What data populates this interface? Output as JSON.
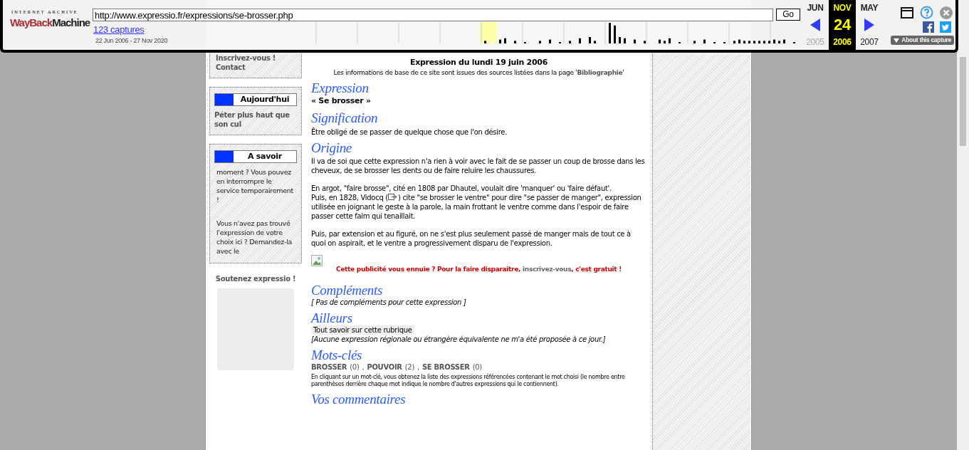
{
  "wayback": {
    "logo_top": "INTERNET ARCHIVE",
    "logo_wayback": "WayBack",
    "logo_machine": "Machine",
    "url": "http://www.expressio.fr/expressions/se-brosser.php",
    "go": "Go",
    "captures": "123 captures",
    "range": "22 Jun 2006 - 27 Nov 2020",
    "months": [
      {
        "month": "JUN",
        "year": "2005",
        "selected": false
      },
      {
        "month": "NOV",
        "day": "24",
        "year": "2006",
        "selected": true
      },
      {
        "month": "MAY",
        "year": "2007",
        "selected": false
      }
    ],
    "about": "About this capture"
  },
  "sidebar": {
    "links": [
      "Inscrivez-vous !",
      "Contact"
    ],
    "boxes": [
      {
        "title": "Aujourd'hui",
        "kind": "link",
        "text": "Péter plus haut que son cul"
      },
      {
        "title": "A savoir",
        "kind": "paragraphs",
        "paragraphs": [
          "moment ? Vous pouvez en interrompre le service temporairement !",
          "Vous n'avez pas trouvé l'expression de votre choix ici ? Demandez-la avec le"
        ]
      }
    ],
    "support": "Soutenez expressio !"
  },
  "main": {
    "date_title": "Expression du lundi 19 juin 2006",
    "source_note": {
      "before": "Les informations de base de ce site sont issues des sources listées dans la page '",
      "link": "Bibliographie",
      "after": "'"
    },
    "expression": {
      "heading": "Expression",
      "text": "« Se brosser »"
    },
    "signification": {
      "heading": "Signification",
      "text": "Être obligé de se passer de quelque chose que l'on désire."
    },
    "origine": {
      "heading": "Origine",
      "paragraphs": [
        {
          "lines": [
            {
              "kind": "text",
              "text": "Il va de soi que cette expression n'a rien à voir avec le fait de se passer un coup de brosse dans les cheveux, de se brosser les dents ou de faire reluire les chaussures."
            }
          ]
        },
        {
          "lines": [
            {
              "kind": "text",
              "text": "En argot, \"faire brosse\", cité en 1808 par Dhautel, voulait dire 'manquer' ou 'faire défaut'."
            },
            {
              "kind": "link_icon",
              "before": "Puis, en 1828, Vidocq (",
              "after": ") cite \"se brosser le ventre\" pour dire \"se passer de manger\", expression utilisée en joignant le geste à la parole, la main frottant le ventre comme dans l'espoir de faire passer cette faim qui tenaillait."
            }
          ]
        },
        {
          "lines": [
            {
              "kind": "text",
              "text": "Puis, par extension et au figuré, on ne s'est plus seulement passé de manger mais de tout ce à quoi on aspirait, et le ventre a progressivement disparu de l'expression."
            }
          ]
        }
      ]
    },
    "ad": {
      "before": "Cette publicité vous ennuie ? Pour la faire disparaître, ",
      "link": "inscrivez-vous",
      "after": ", c'est gratuit !"
    },
    "complements": {
      "heading": "Compléments",
      "text": "[ Pas de compléments pour cette expression ]"
    },
    "ailleurs": {
      "heading": "Ailleurs",
      "button": "Tout savoir sur cette rubrique",
      "text": "[Aucune expression régionale ou étrangère équivalente ne m'a été proposée à ce jour.]"
    },
    "mots_cles": {
      "heading": "Mots-clés",
      "keywords": [
        {
          "word": "BROSSER",
          "count": "(0)"
        },
        {
          "word": "POUVOIR",
          "count": "(2)"
        },
        {
          "word": "SE BROSSER",
          "count": "(0)"
        }
      ],
      "separator": ",",
      "note": "En cliquant sur un mot-clé, vous obtenez la liste des expressions référencées contenant le mot choisi (le nombre entre parenthèses derrière chaque mot indique le nombre d'autres expressions qui le contiennent)."
    },
    "commentaires": {
      "heading": "Vos commentaires"
    }
  }
}
